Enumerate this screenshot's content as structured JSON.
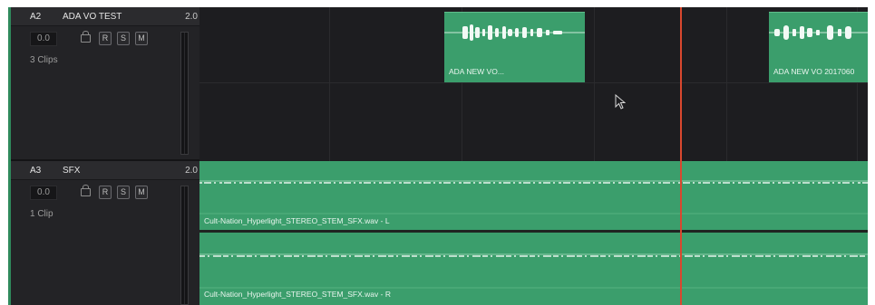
{
  "tracks": [
    {
      "id": "A2",
      "name": "ADA VO TEST",
      "number": "2.0",
      "volume": "0.0",
      "buttons": [
        "R",
        "S",
        "M"
      ],
      "clip_count": "3 Clips",
      "clips": [
        {
          "label": "ADA NEW VO..."
        },
        {
          "label": "ADA NEW VO 2017060"
        }
      ]
    },
    {
      "id": "A3",
      "name": "SFX",
      "number": "2.0",
      "volume": "0.0",
      "buttons": [
        "R",
        "S",
        "M"
      ],
      "clip_count": "1 Clip",
      "clips": [
        {
          "label": "Cult-Nation_Hyperlight_STEREO_STEM_SFX.wav - L"
        },
        {
          "label": "Cult-Nation_Hyperlight_STEREO_STEM_SFX.wav - R"
        }
      ]
    }
  ],
  "colors": {
    "clip": "#3b9e6c",
    "playhead": "#d9472f",
    "panel": "#232326"
  },
  "icons": [
    "lock-icon",
    "mouse-pointer-icon"
  ]
}
